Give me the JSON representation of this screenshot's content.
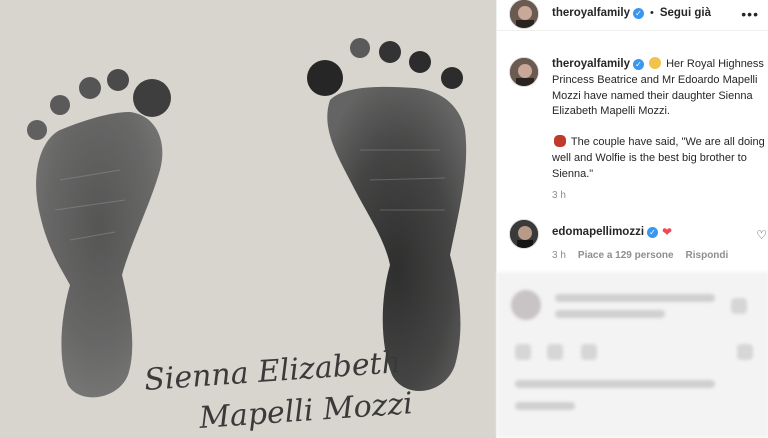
{
  "post": {
    "header": {
      "username": "theroyalfamily",
      "separator": "•",
      "follow_label": "Segui già",
      "more_label": "•••"
    },
    "caption": {
      "username": "theroyalfamily",
      "text_part1": "Her Royal Highness Princess Beatrice and Mr Edoardo Mapelli Mozzi have named their daughter Sienna Elizabeth Mapelli Mozzi.",
      "text_part2": "The couple have said, \"We are all doing well and Wolfie is the best big brother to Sienna.\"",
      "time": "3 h"
    },
    "comment": {
      "username": "edomapellimozzi",
      "heart": "❤",
      "time": "3 h",
      "likes": "Piace a 129 persone",
      "reply_label": "Rispondi"
    },
    "image": {
      "script_line1": "Sienna Elizabeth",
      "script_line2": "Mapelli Mozzi"
    }
  },
  "colors": {
    "verified": "#3897f0",
    "heart": "#ed4956",
    "paper": "#d8d4ce",
    "ink": "#2a2a2a"
  },
  "icons": [
    "verified-badge-icon",
    "more-options-icon",
    "baby-emoji-icon",
    "lips-emoji-icon",
    "heart-emoji-icon",
    "like-heart-icon"
  ]
}
